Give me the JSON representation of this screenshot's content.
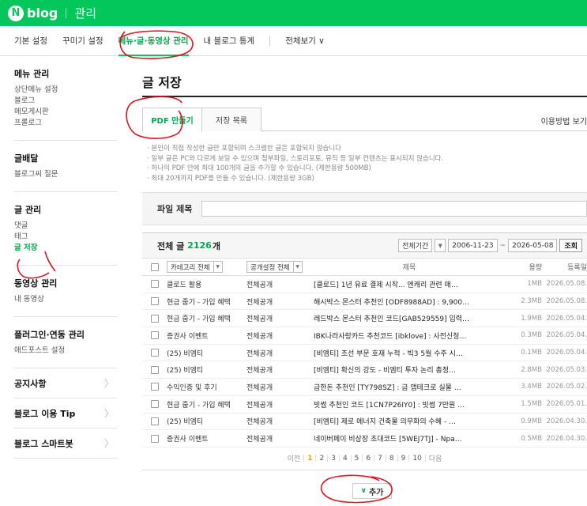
{
  "header": {
    "logo_letter": "N",
    "brand": "blog",
    "section": "관리"
  },
  "tabs": [
    {
      "label": "기본 설정"
    },
    {
      "label": "꾸미기 설정"
    },
    {
      "label": "메뉴·글·동영상 관리"
    },
    {
      "label": "내 블로그 통계"
    },
    {
      "label": "전체보기 ∨"
    }
  ],
  "sidebar": {
    "menu_title": "메뉴 관리",
    "menu_items": [
      "상단메뉴 설정",
      "블로그",
      "메모게시판",
      "프롤로그"
    ],
    "dist_title": "글배달",
    "dist_items": [
      "블로그씨 질문"
    ],
    "post_title": "글 관리",
    "post_items": [
      "댓글",
      "태그",
      "글 저장"
    ],
    "video_title": "동영상 관리",
    "video_items": [
      "내 동영상"
    ],
    "plugin_title": "플러그인·연동 관리",
    "plugin_items": [
      "애드포스트 설정"
    ],
    "notice": "공지사항",
    "tips": "블로그 이용 Tip",
    "smartbot": "블로그 스마트봇",
    "chevron": "〉"
  },
  "main": {
    "title": "글 저장",
    "subtab_pdf": "PDF 만들기",
    "subtab_list": "저장 목록",
    "howto": "이용방법 보기",
    "notes": [
      "· 본인이 직접 작성한 글만 포함되며 스크랩한 글은 포함되지 않습니다",
      "· 일부 글은 PC와 다르게 보일 수 있으며 첨부파일, 스토리포토, 뮤직 등 일부 컨텐츠는 표시되지 않습니다.",
      "· 하나의 PDF 안에 최대 100개의 글을 추가할 수 있습니다. (제한용량 500MB)",
      "· 최대 20개까지 PDF를 만들 수 있습니다. (제한용량 3GB)"
    ],
    "file_title_label": "파일 제목",
    "list_title": "전체 글",
    "count": "2126",
    "count_unit": "개",
    "period_label": "전체기간",
    "date_from": "2006-11-23",
    "date_sep": "~",
    "date_to": "2026-05-08",
    "search_btn": "조회",
    "col_category": "카테고리 전체",
    "col_visibility": "공개설정 전체",
    "col_title": "제목",
    "col_size": "용량",
    "col_date": "등록일",
    "rows": [
      {
        "category": "클로드 활용",
        "visibility": "전체공개",
        "title": "[클로드] 1년 유료 결제 시작... 엔캐리 관련 매…",
        "size": "1MB",
        "date": "2026.05.08."
      },
      {
        "category": "현금 줍기 - 가입 혜택",
        "visibility": "전체공개",
        "title": "해시박스 몬스터 추천인 [ODF8988AD] : 9,900…",
        "size": "2.3MB",
        "date": "2026.05.08."
      },
      {
        "category": "현금 줍기 - 가입 혜택",
        "visibility": "전체공개",
        "title": "레드박스 몬스터 추천인 코드[GAB529559] 입력…",
        "size": "1.9MB",
        "date": "2026.05.04."
      },
      {
        "category": "증권사 이벤트",
        "visibility": "전체공개",
        "title": "IBK나라사랑카드 추천코드 [ibklove] : 사전신청…",
        "size": "0.3MB",
        "date": "2026.05.04."
      },
      {
        "category": "(25) 비엠티",
        "visibility": "전체공개",
        "title": "[비엠티] 조선 부문 호재 누적 - 빅3 5월 수주 시…",
        "size": "0.1MB",
        "date": "2026.05.04."
      },
      {
        "category": "(25) 비엠티",
        "visibility": "전체공개",
        "title": "[비엠티] 확신의 강도 - 비엠티 투자 논리 총정…",
        "size": "2.8MB",
        "date": "2026.05.03."
      },
      {
        "category": "수익인증 및 후기",
        "visibility": "전체공개",
        "title": "금한돈 추천인 [TY798SZ] : 금 앱테크로 실물 …",
        "size": "3.4MB",
        "date": "2026.05.02."
      },
      {
        "category": "현금 줍기 - 가입 혜택",
        "visibility": "전체공개",
        "title": "빗썸 추천인 코드 [1CN7P26IY0] : 빗썸 7만원 …",
        "size": "1.5MB",
        "date": "2026.05.01."
      },
      {
        "category": "(25) 비엠티",
        "visibility": "전체공개",
        "title": "[비엠티] 제로 에너지 건축물 의무화의 수혜 - …",
        "size": "0.9MB",
        "date": "2026.04.30."
      },
      {
        "category": "증권사 이벤트",
        "visibility": "전체공개",
        "title": "네이버페이 비상장 초대코드 [5WEJ7TJ] - Npa…",
        "size": "0.5MB",
        "date": "2026.04.30."
      }
    ],
    "pager_prev": "이전",
    "pages": [
      "1",
      "2",
      "3",
      "4",
      "5",
      "6",
      "7",
      "8",
      "9",
      "10"
    ],
    "pager_next": "다음",
    "more_chevron": "∨",
    "more_label": "추가"
  },
  "colors": {
    "brand_green": "#03c75a",
    "annotation_red": "#e0141e",
    "pager_active": "#f0a000"
  }
}
